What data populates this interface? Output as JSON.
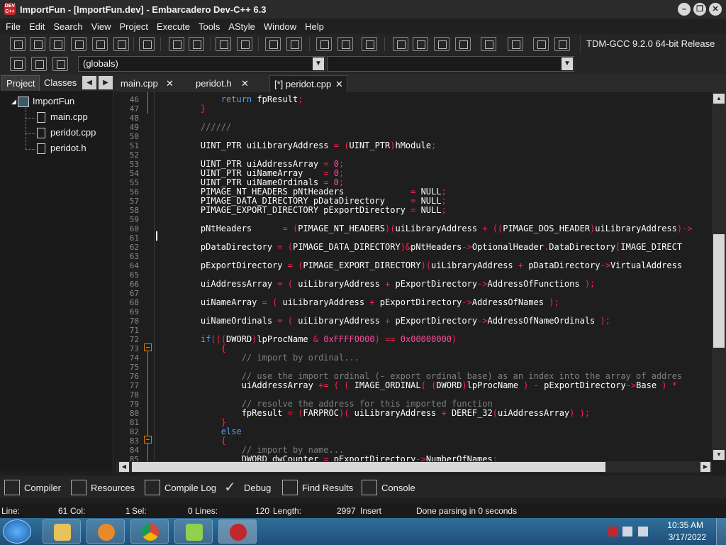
{
  "window": {
    "title": "ImportFun - [ImportFun.dev] - Embarcadero Dev-C++ 6.3",
    "app_icon_label": "DEV C++",
    "controls": [
      "minimize",
      "restore",
      "close"
    ]
  },
  "menu": [
    "File",
    "Edit",
    "Search",
    "View",
    "Project",
    "Execute",
    "Tools",
    "AStyle",
    "Window",
    "Help"
  ],
  "toolbar": {
    "compiler": "TDM-GCC 9.2.0 64-bit Release",
    "globals": "(globals)",
    "member": ""
  },
  "left_panel": {
    "tabs": [
      "Project",
      "Classes"
    ],
    "tree": {
      "project": "ImportFun",
      "files": [
        "main.cpp",
        "peridot.cpp",
        "peridot.h"
      ]
    }
  },
  "editor_tabs": [
    {
      "label": "main.cpp",
      "active": false
    },
    {
      "label": "peridot.h",
      "active": false
    },
    {
      "label": "[*] peridot.cpp",
      "active": true
    }
  ],
  "code_lines": [
    {
      "n": "46",
      "html": "        <span class=\"kw\">return</span> fpResult<span class=\"op\">;</span>"
    },
    {
      "n": "47",
      "html": "    <span class=\"op\">}</span>"
    },
    {
      "n": "48",
      "html": ""
    },
    {
      "n": "49",
      "html": "    <span class=\"cm\">//////</span>"
    },
    {
      "n": "50",
      "html": ""
    },
    {
      "n": "51",
      "html": "    UINT_PTR uiLibraryAddress <span class=\"op\">=</span> <span class=\"op\">(</span>UINT_PTR<span class=\"op\">)</span>hModule<span class=\"op\">;</span>"
    },
    {
      "n": "52",
      "html": ""
    },
    {
      "n": "53",
      "html": "    UINT_PTR uiAddressArray <span class=\"op\">=</span> <span class=\"nm\">0</span><span class=\"op\">;</span>"
    },
    {
      "n": "54",
      "html": "    UINT_PTR uiNameArray    <span class=\"op\">=</span> <span class=\"nm\">0</span><span class=\"op\">;</span>"
    },
    {
      "n": "55",
      "html": "    UINT_PTR uiNameOrdinals <span class=\"op\">=</span> <span class=\"nm\">0</span><span class=\"op\">;</span>"
    },
    {
      "n": "56",
      "html": "    PIMAGE_NT_HEADERS pNtHeaders             <span class=\"op\">=</span> NULL<span class=\"op\">;</span>"
    },
    {
      "n": "57",
      "html": "    PIMAGE_DATA_DIRECTORY pDataDirectory     <span class=\"op\">=</span> NULL<span class=\"op\">;</span>"
    },
    {
      "n": "58",
      "html": "    PIMAGE_EXPORT_DIRECTORY pExportDirectory <span class=\"op\">=</span> NULL<span class=\"op\">;</span>"
    },
    {
      "n": "59",
      "html": ""
    },
    {
      "n": "60",
      "html": "    pNtHeaders      <span class=\"op\">=</span> <span class=\"op\">(</span>PIMAGE_NT_HEADERS<span class=\"op\">)(</span>uiLibraryAddress <span class=\"op\">+</span> <span class=\"op\">((</span>PIMAGE_DOS_HEADER<span class=\"op\">)</span>uiLibraryAddress<span class=\"op\">)-&gt;</span>"
    },
    {
      "n": "61",
      "html": ""
    },
    {
      "n": "62",
      "html": "    pDataDirectory <span class=\"op\">=</span> <span class=\"op\">(</span>PIMAGE_DATA_DIRECTORY<span class=\"op\">)&amp;</span>pNtHeaders<span class=\"op\">-&gt;</span>OptionalHeader<span class=\"op\">.</span>DataDirectory<span class=\"op\">[</span>IMAGE_DIRECT"
    },
    {
      "n": "63",
      "html": ""
    },
    {
      "n": "64",
      "html": "    pExportDirectory <span class=\"op\">=</span> <span class=\"op\">(</span>PIMAGE_EXPORT_DIRECTORY<span class=\"op\">)(</span>uiLibraryAddress <span class=\"op\">+</span> pDataDirectory<span class=\"op\">-&gt;</span>VirtualAddress"
    },
    {
      "n": "65",
      "html": ""
    },
    {
      "n": "66",
      "html": "    uiAddressArray <span class=\"op\">=</span> <span class=\"op\">(</span> uiLibraryAddress <span class=\"op\">+</span> pExportDirectory<span class=\"op\">-&gt;</span>AddressOfFunctions <span class=\"op\">);</span>"
    },
    {
      "n": "67",
      "html": ""
    },
    {
      "n": "68",
      "html": "    uiNameArray <span class=\"op\">=</span> <span class=\"op\">(</span> uiLibraryAddress <span class=\"op\">+</span> pExportDirectory<span class=\"op\">-&gt;</span>AddressOfNames <span class=\"op\">);</span>"
    },
    {
      "n": "69",
      "html": ""
    },
    {
      "n": "70",
      "html": "    uiNameOrdinals <span class=\"op\">=</span> <span class=\"op\">(</span> uiLibraryAddress <span class=\"op\">+</span> pExportDirectory<span class=\"op\">-&gt;</span>AddressOfNameOrdinals <span class=\"op\">);</span>"
    },
    {
      "n": "71",
      "html": ""
    },
    {
      "n": "72",
      "html": "    <span class=\"kw\">if</span><span class=\"op\">(((</span>DWORD<span class=\"op\">)</span>lpProcName <span class=\"op\">&amp;</span> <span class=\"hx\">0xFFFF0000</span><span class=\"op\">)</span> <span class=\"op\">==</span> <span class=\"hx\">0x00000000</span><span class=\"op\">)</span>"
    },
    {
      "n": "73",
      "html": "        <span class=\"op\">{</span>"
    },
    {
      "n": "74",
      "html": "            <span class=\"cm\">// import by ordinal...</span>"
    },
    {
      "n": "75",
      "html": ""
    },
    {
      "n": "76",
      "html": "            <span class=\"cm\">// use the import ordinal (- export ordinal base) as an index into the array of addres</span>"
    },
    {
      "n": "77",
      "html": "            uiAddressArray <span class=\"op\">+=</span> <span class=\"op\">(</span> <span class=\"op\">(</span> IMAGE_ORDINAL<span class=\"op\">(</span> <span class=\"op\">(</span>DWORD<span class=\"op\">)</span>lpProcName <span class=\"op\">)</span> <span class=\"op\">-</span> pExportDirectory<span class=\"op\">-&gt;</span>Base <span class=\"op\">)</span> <span class=\"op\">*</span>"
    },
    {
      "n": "78",
      "html": ""
    },
    {
      "n": "79",
      "html": "            <span class=\"cm\">// resolve the address for this imported function</span>"
    },
    {
      "n": "80",
      "html": "            fpResult <span class=\"op\">=</span> <span class=\"op\">(</span>FARPROC<span class=\"op\">)(</span> uiLibraryAddress <span class=\"op\">+</span> DEREF_32<span class=\"op\">(</span>uiAddressArray<span class=\"op\">)</span> <span class=\"op\">);</span>"
    },
    {
      "n": "81",
      "html": "        <span class=\"op\">}</span>"
    },
    {
      "n": "82",
      "html": "        <span class=\"kw\">else</span>"
    },
    {
      "n": "83",
      "html": "        <span class=\"op\">{</span>"
    },
    {
      "n": "84",
      "html": "            <span class=\"cm\">// import by name...</span>"
    },
    {
      "n": "85",
      "html": "            DWORD dwCounter <span class=\"op\">=</span> pExportDirectory<span class=\"op\">-&gt;</span>NumberOfNames<span class=\"op\">;</span>"
    }
  ],
  "bottom_tabs": [
    "Compiler",
    "Resources",
    "Compile Log",
    "Debug",
    "Find Results",
    "Console"
  ],
  "status": {
    "line_label": "Line:",
    "line_value": "61",
    "col_label": "Col:",
    "col_value": "1",
    "sel_label": "Sel:",
    "sel_value": "0",
    "lines_label": "Lines:",
    "lines_value": "120",
    "length_label": "Length:",
    "length_value": "2997",
    "mode": "Insert",
    "message": "Done parsing in 0 seconds"
  },
  "taskbar": {
    "time": "10:35 AM",
    "date": "3/17/2022",
    "apps": [
      "file-explorer",
      "media-player",
      "chrome",
      "notepad-plus-plus",
      "dev-cpp"
    ]
  },
  "colors": {
    "keyword": "#4ea1ff",
    "comment": "#7f7f7f",
    "operator": "#ff2050",
    "number": "#ff4aa0",
    "fold": "#d97a00"
  }
}
